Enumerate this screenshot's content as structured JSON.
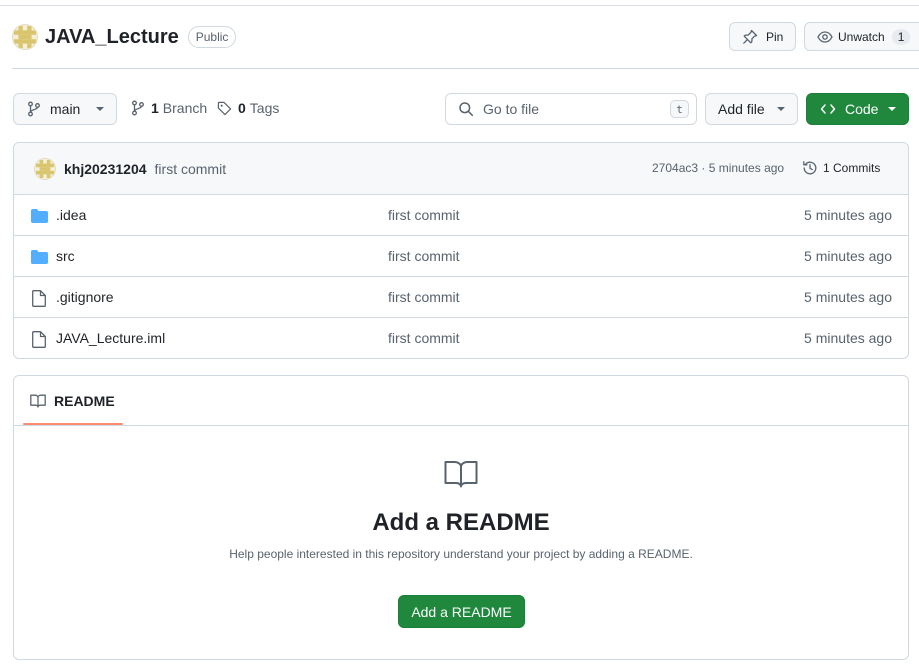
{
  "repo": {
    "avatar_icon": "identicon-avatar",
    "name": "JAVA_Lecture",
    "visibility": "Public",
    "pin_label": "Pin",
    "watch_label": "Unwatch",
    "watch_count": "1"
  },
  "toolbar": {
    "branch_name": "main",
    "branch_count": "1",
    "branch_label": "Branch",
    "tag_count": "0",
    "tag_label": "Tags",
    "search_placeholder": "Go to file",
    "search_shortcut": "t",
    "add_file_label": "Add file",
    "code_label": "Code"
  },
  "latest_commit": {
    "author": "khj20231204",
    "message": "first commit",
    "meta": "2704ac3 · 5 minutes ago",
    "commits_label": "1 Commits"
  },
  "files": [
    {
      "type": "folder",
      "name": ".idea",
      "commit": "first commit",
      "time": "5 minutes ago"
    },
    {
      "type": "folder",
      "name": "src",
      "commit": "first commit",
      "time": "5 minutes ago"
    },
    {
      "type": "file",
      "name": ".gitignore",
      "commit": "first commit",
      "time": "5 minutes ago"
    },
    {
      "type": "file",
      "name": "JAVA_Lecture.iml",
      "commit": "first commit",
      "time": "5 minutes ago"
    }
  ],
  "readme": {
    "tab_label": "README",
    "blank_title": "Add a README",
    "blank_description": "Help people interested in this repository understand your project by adding a README.",
    "add_button_label": "Add a README"
  },
  "colors": {
    "primary_green": "#1f883d",
    "folder_blue": "#54aeff",
    "tab_underline": "#fd8c73",
    "muted_text": "#59636e",
    "border": "#d1d9e0"
  }
}
